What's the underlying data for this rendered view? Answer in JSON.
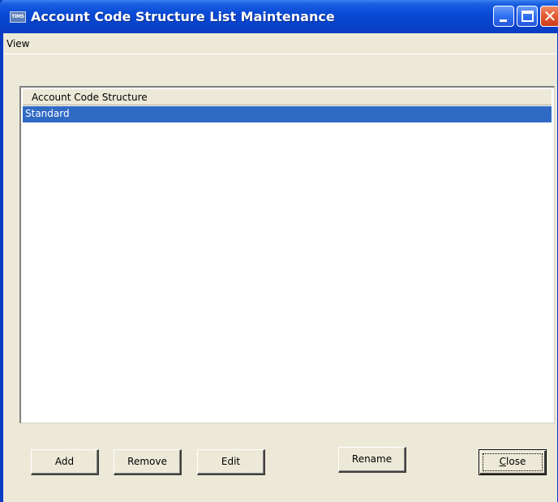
{
  "window": {
    "title": "Account Code Structure List Maintenance",
    "icon_label": "TIMS"
  },
  "menu": {
    "items": [
      "View"
    ]
  },
  "list": {
    "column_header": "Account Code Structure",
    "rows": [
      "Standard"
    ],
    "selected_index": 0
  },
  "buttons": {
    "add": "Add",
    "remove": "Remove",
    "edit": "Edit",
    "rename": "Rename",
    "close_prefix": "C",
    "close_rest": "lose"
  },
  "colors": {
    "titlebar": "#0a4ad6",
    "selection": "#316ac5",
    "window_bg": "#ece9d8"
  }
}
